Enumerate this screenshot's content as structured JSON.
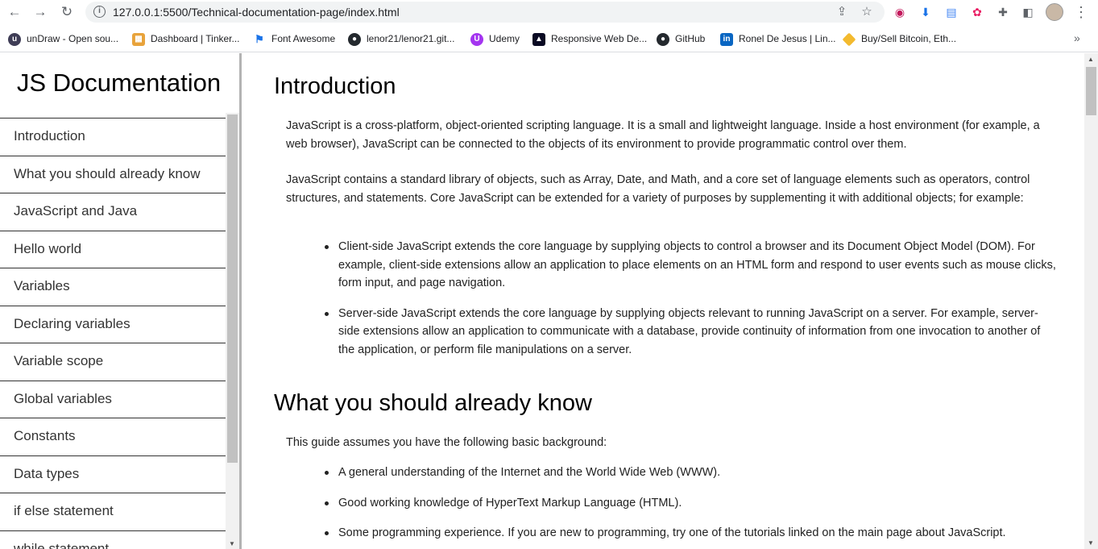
{
  "browser": {
    "url": "127.0.0.1:5500/Technical-documentation-page/index.html",
    "back_icon": "←",
    "forward_icon": "→",
    "reload_icon": "↻"
  },
  "bookmarks": [
    {
      "label": "unDraw - Open sou...",
      "icon": "undraw-icon",
      "color": "#3f3d56"
    },
    {
      "label": "Dashboard | Tinker...",
      "icon": "tinkercad-icon",
      "color": "#e8a33b"
    },
    {
      "label": "Font Awesome",
      "icon": "flag-icon",
      "color": "#1a73e8"
    },
    {
      "label": "lenor21/lenor21.git...",
      "icon": "github-icon",
      "color": "#24292e"
    },
    {
      "label": "Udemy",
      "icon": "udemy-icon",
      "color": "#a435f0"
    },
    {
      "label": "Responsive Web De...",
      "icon": "freecodecamp-icon",
      "color": "#0a0a23"
    },
    {
      "label": "GitHub",
      "icon": "github-icon",
      "color": "#24292e"
    },
    {
      "label": "Ronel De Jesus | Lin...",
      "icon": "linkedin-icon",
      "color": "#0a66c2"
    },
    {
      "label": "Buy/Sell Bitcoin, Eth...",
      "icon": "binance-icon",
      "color": "#f3ba2f"
    }
  ],
  "sidebar": {
    "title": "JS Documentation",
    "items": [
      "Introduction",
      "What you should already know",
      "JavaScript and Java",
      "Hello world",
      "Variables",
      "Declaring variables",
      "Variable scope",
      "Global variables",
      "Constants",
      "Data types",
      "if else statement",
      "while statement"
    ]
  },
  "main": {
    "intro_heading": "Introduction",
    "intro_p1": "JavaScript is a cross-platform, object-oriented scripting language. It is a small and lightweight language. Inside a host environment (for example, a web browser), JavaScript can be connected to the objects of its environment to provide programmatic control over them.",
    "intro_p2": "JavaScript contains a standard library of objects, such as Array, Date, and Math, and a core set of language elements such as operators, control structures, and statements. Core JavaScript can be extended for a variety of purposes by supplementing it with additional objects; for example:",
    "intro_bullets": [
      "Client-side JavaScript extends the core language by supplying objects to control a browser and its Document Object Model (DOM). For example, client-side extensions allow an application to place elements on an HTML form and respond to user events such as mouse clicks, form input, and page navigation.",
      "Server-side JavaScript extends the core language by supplying objects relevant to running JavaScript on a server. For example, server-side extensions allow an application to communicate with a database, provide continuity of information from one invocation to another of the application, or perform file manipulations on a server."
    ],
    "know_heading": "What you should already know",
    "know_p1": "This guide assumes you have the following basic background:",
    "know_bullets": [
      "A general understanding of the Internet and the World Wide Web (WWW).",
      "Good working knowledge of HyperText Markup Language (HTML).",
      "Some programming experience. If you are new to programming, try one of the tutorials linked on the main page about JavaScript."
    ]
  }
}
